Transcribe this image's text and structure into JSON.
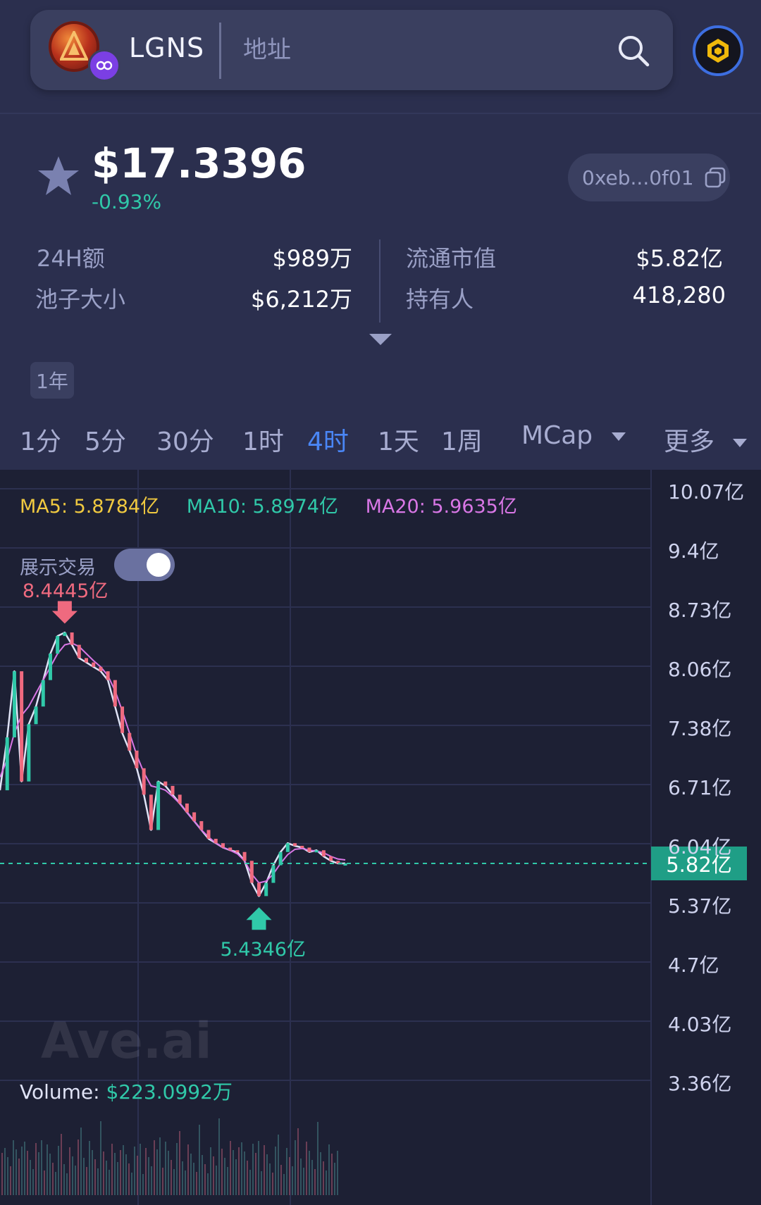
{
  "header": {
    "token_name": "LGNS",
    "address_placeholder": "地址"
  },
  "price": {
    "value": "$17.3396",
    "change": "-0.93%",
    "change_color": "#30c9a9",
    "contract_short": "0xeb...0f01"
  },
  "stats": {
    "vol24h_label": "24H额",
    "vol24h_value": "$989万",
    "pool_label": "池子大小",
    "pool_value": "$6,212万",
    "circ_mcap_label": "流通市值",
    "circ_mcap_value": "$5.82亿",
    "holders_label": "持有人",
    "holders_value": "418,280"
  },
  "range_chip": "1年",
  "tabs": [
    {
      "label": "1分"
    },
    {
      "label": "5分"
    },
    {
      "label": "30分"
    },
    {
      "label": "1时"
    },
    {
      "label": "4时",
      "active": true
    },
    {
      "label": "1天"
    },
    {
      "label": "1周"
    },
    {
      "label": "MCap"
    },
    {
      "label": "更多"
    }
  ],
  "chart": {
    "ma5": "MA5: 5.8784亿",
    "ma10": "MA10: 5.8974亿",
    "ma20": "MA20: 5.9635亿",
    "ma5_color": "#f0c940",
    "ma10_color": "#30c9a9",
    "ma20_color": "#d977e6",
    "show_trades_label": "展示交易",
    "show_trades_on": true,
    "high_marker": "8.4445亿",
    "low_marker": "5.4346亿",
    "current_value": "5.82亿",
    "volume_label": "Volume:",
    "volume_value": "$223.0992万",
    "watermark": "Ave.ai",
    "y_axis": [
      "10.07亿",
      "9.4亿",
      "8.73亿",
      "8.06亿",
      "7.38亿",
      "6.71亿",
      "6.04亿",
      "5.37亿",
      "4.7亿",
      "4.03亿",
      "3.36亿"
    ]
  },
  "chart_data": {
    "type": "line",
    "title": "",
    "unit": "亿",
    "x": [
      0,
      1,
      2,
      3,
      4,
      5,
      6,
      7,
      8,
      9,
      10,
      11,
      12,
      13,
      14,
      15,
      16,
      17,
      18,
      19,
      20,
      21,
      22,
      23,
      24,
      25,
      26,
      27,
      28,
      29,
      30,
      31,
      32,
      33,
      34,
      35,
      36,
      37,
      38,
      39,
      40,
      41,
      42,
      43,
      44,
      45,
      46,
      47,
      48
    ],
    "series": [
      {
        "name": "MCap",
        "color": "#e0e3f6",
        "values": [
          6.65,
          7.25,
          8.0,
          6.75,
          7.4,
          7.6,
          7.9,
          8.2,
          8.4,
          8.44,
          8.3,
          8.15,
          8.1,
          8.05,
          8.0,
          7.9,
          7.6,
          7.3,
          7.1,
          6.9,
          6.6,
          6.2,
          6.75,
          6.7,
          6.6,
          6.5,
          6.4,
          6.3,
          6.2,
          6.1,
          6.05,
          6.0,
          5.97,
          5.95,
          5.85,
          5.6,
          5.45,
          5.6,
          5.8,
          5.95,
          6.05,
          6.02,
          6.0,
          5.95,
          5.97,
          5.9,
          5.85,
          5.82,
          5.82
        ]
      },
      {
        "name": "MA20",
        "color": "#d977e6",
        "values": [
          6.8,
          7.0,
          7.3,
          7.5,
          7.6,
          7.75,
          7.9,
          8.05,
          8.2,
          8.3,
          8.32,
          8.28,
          8.2,
          8.12,
          8.05,
          7.95,
          7.78,
          7.55,
          7.3,
          7.05,
          6.85,
          6.7,
          6.68,
          6.65,
          6.58,
          6.5,
          6.4,
          6.3,
          6.2,
          6.12,
          6.05,
          6.0,
          5.97,
          5.93,
          5.85,
          5.7,
          5.6,
          5.62,
          5.7,
          5.82,
          5.92,
          5.98,
          5.99,
          5.97,
          5.96,
          5.94,
          5.9,
          5.87,
          5.86
        ]
      }
    ],
    "ylim": [
      3.36,
      10.07
    ],
    "highlights": {
      "high": 8.4445,
      "low": 5.4346,
      "current": 5.82
    }
  }
}
